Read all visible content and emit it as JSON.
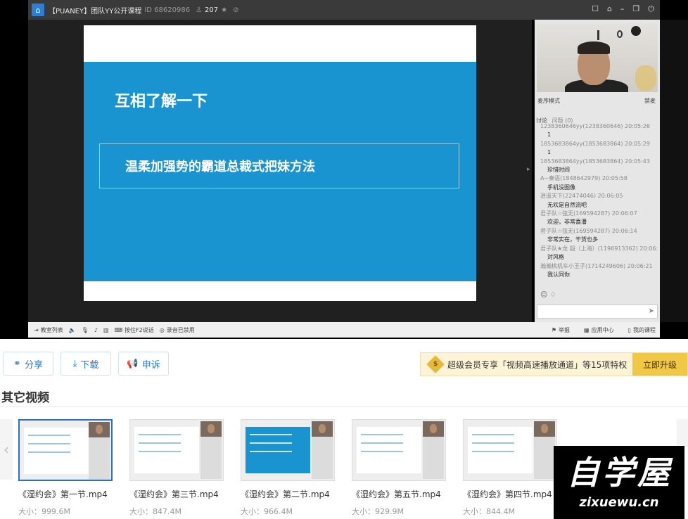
{
  "titlebar": {
    "channel": "【PUANEY】团队YY公开课程",
    "id_label": "ID 68620986",
    "viewers": "207"
  },
  "slide": {
    "title": "互相了解一下",
    "subtitle": "温柔加强势的霸道总裁式把妹方法"
  },
  "chatpanel": {
    "mode_label": "麦序模式",
    "mode_right": "禁麦",
    "chat_tab": "讨论",
    "chat_tab_sub": "问题",
    "chat_tab_count": "(0)",
    "messages": [
      {
        "user": "1238360646yy(1238360646) 20:05:26",
        "text": "1"
      },
      {
        "user": "1853683864yy(1853683864) 20:05:29",
        "text": "1"
      },
      {
        "user": "1853683864yy(1853683864) 20:05:43",
        "text": "珍惜时间"
      },
      {
        "user": "A~秦语(1848642979) 20:05:58",
        "text": "手机没图像"
      },
      {
        "user": "逍遥天下(22474046) 20:06:05",
        "text": "无欢是自然流吧"
      },
      {
        "user": "君子队☆弦无(169594287) 20:06:07",
        "text": "欢迎，非常喜潘"
      },
      {
        "user": "君子队☆弦无(169594287) 20:06:14",
        "text": "非常实在，干货也多"
      },
      {
        "user": "君子队★龙 超（上海）(1196913362) 20:06:",
        "text": "対风格"
      },
      {
        "user": "瀚瀚桃机车小王子(1714249606) 20:06:21",
        "text": "我认同你"
      }
    ]
  },
  "bottombar": {
    "course_list": "教室列表",
    "hotkey": "按住F2说话",
    "record": "录音已禁用",
    "report": "举报",
    "app_center": "应用中心",
    "my_course": "我的课程"
  },
  "actions": {
    "share": "分享",
    "download": "下载",
    "complain": "申诉"
  },
  "vip": {
    "badge": "$",
    "text": "超级会员专享「视频高速播放通道」等15项特权",
    "upgrade": "立即升级"
  },
  "section_title": "其它视频",
  "videos": [
    {
      "name": "《湿约会》第一节.mp4",
      "size": "大小：999.6M"
    },
    {
      "name": "《湿约会》第三节.mp4",
      "size": "大小：847.4M"
    },
    {
      "name": "《湿约会》第二节.mp4",
      "size": "大小：966.4M"
    },
    {
      "name": "《湿约会》第五节.mp4",
      "size": "大小：929.9M"
    },
    {
      "name": "《湿约会》第四节.mp4",
      "size": "大小：844.4M"
    }
  ],
  "logo": {
    "text": "自学屋",
    "url": "zixuewu.cn"
  },
  "icons": {
    "home": "home-icon",
    "share": "share-icon",
    "download": "download-icon",
    "complain": "megaphone-icon"
  },
  "colors": {
    "slide_blue": "#1a93d1",
    "accent": "#1f7ad8",
    "vip_gold": "#f1c746"
  }
}
